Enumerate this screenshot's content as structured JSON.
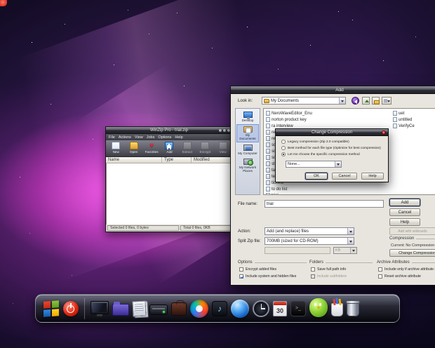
{
  "icons": {
    "music_note": "♪",
    "prompt": ">_",
    "heart": "♥"
  },
  "winzip": {
    "title": "WinZip Pro - trial.zip",
    "menu": [
      "File",
      "Actions",
      "View",
      "Jobs",
      "Options",
      "Help"
    ],
    "toolbar": [
      "New",
      "Open",
      "Favorites",
      "Add",
      "Extract",
      "Encrypt",
      "View"
    ],
    "columns": [
      "Name",
      "Type",
      "Modified"
    ],
    "status_left": "Selected 0 files, 0 bytes",
    "status_right": "Total 0 files, 0KB"
  },
  "add_dialog": {
    "title": "Add",
    "look_in_label": "Look in:",
    "look_in_value": "My Documents",
    "places": [
      "Desktop",
      "My Documents",
      "My Computer",
      "My Network Places"
    ],
    "files_col1": [
      "NeroWaveEditor_Enu",
      "norton product key",
      "ra interview",
      "recipes",
      "resume",
      "school work",
      "screenshots",
      "songs",
      "stuff",
      "taxes",
      "temp",
      "tickets",
      "to do list",
      "trial"
    ],
    "files_col2": [
      "uet",
      "untitled",
      "VerifyCe"
    ],
    "file_name_label": "File name:",
    "file_name_value": "trial",
    "btn_add": "Add",
    "btn_cancel": "Cancel",
    "btn_help": "Help",
    "btn_wildcards": "Add with wildcards",
    "action_label": "Action:",
    "action_value": "Add (and replace) files",
    "split_label": "Split Zip file:",
    "split_value": "700MB (sized for CD-ROM)",
    "split_unit": "KB",
    "compression_title": "Compression",
    "compression_current": "Current: No Compression",
    "btn_change_compression": "Change Compression...",
    "options_title": "Options",
    "opt_encrypt": "Encrypt added files",
    "opt_hidden": "Include system and hidden files",
    "folders_title": "Folders",
    "fol_path": "Save full path info",
    "fol_sub": "Include subfolders",
    "archive_title": "Archive Attributes",
    "arc_only": "Include only if archive attribute is set",
    "arc_reset": "Reset archive attribute"
  },
  "compression_dialog": {
    "title": "Change Compression",
    "radio_legacy": "Legacy compression (Zip 2.0 compatible)",
    "radio_best": "Best method for each file type (Optimize for best compression)",
    "radio_choose": "Let me choose the specific compression method",
    "method_value": "None...",
    "btn_ok": "OK",
    "btn_cancel": "Cancel",
    "btn_help": "Help"
  },
  "dock": {
    "calendar_day": "30"
  }
}
